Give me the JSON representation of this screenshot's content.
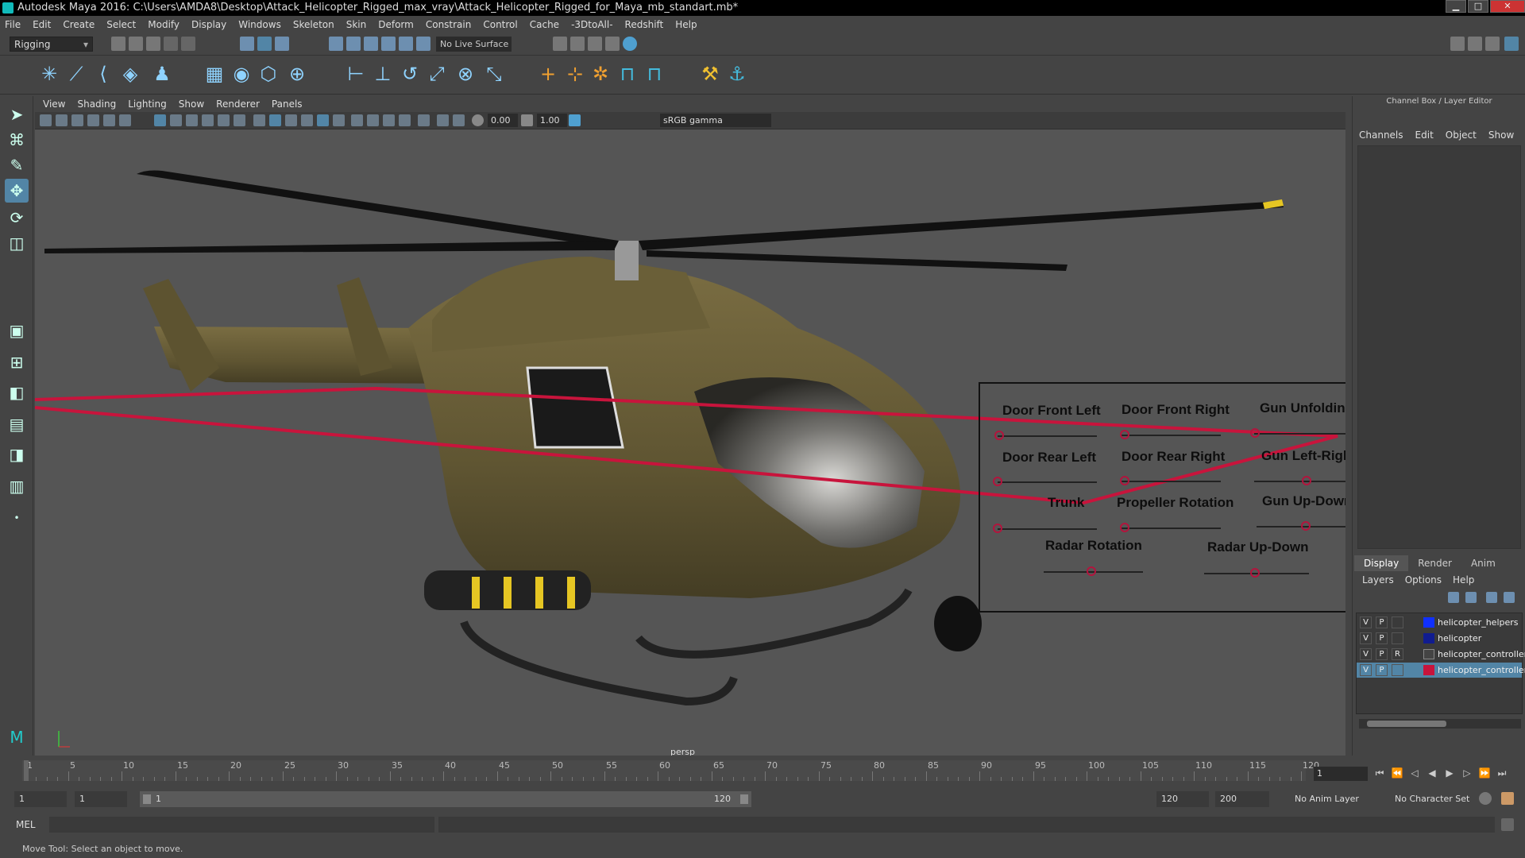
{
  "window": {
    "title": "Autodesk Maya 2016: C:\\Users\\AMDA8\\Desktop\\Attack_Helicopter_Rigged_max_vray\\Attack_Helicopter_Rigged_for_Maya_mb_standart.mb*",
    "minimize": "▁",
    "maximize": "□",
    "close": "✕"
  },
  "menubar": [
    "File",
    "Edit",
    "Create",
    "Select",
    "Modify",
    "Display",
    "Windows",
    "Skeleton",
    "Skin",
    "Deform",
    "Constrain",
    "Control",
    "Cache",
    "-3DtoAll-",
    "Redshift",
    "Help"
  ],
  "status": {
    "mode": "Rigging",
    "live_surface": "No Live Surface"
  },
  "viewport": {
    "menu": [
      "View",
      "Shading",
      "Lighting",
      "Show",
      "Renderer",
      "Panels"
    ],
    "exposure": "0.00",
    "gamma": "1.00",
    "color_space": "sRGB gamma",
    "camera_label": "persp"
  },
  "controls": {
    "door_front_left": "Door Front Left",
    "door_front_right": "Door Front Right",
    "gun_unfolding": "Gun Unfolding",
    "door_rear_left": "Door Rear Left",
    "door_rear_right": "Door Rear Right",
    "gun_left_right": "Gun Left-Right",
    "trunk": "Trunk",
    "propeller_rotation": "Propeller Rotation",
    "gun_up_down": "Gun Up-Down",
    "radar_rotation": "Radar Rotation",
    "radar_up_down": "Radar Up-Down"
  },
  "channel_box": {
    "title": "Channel Box / Layer Editor",
    "menu": [
      "Channels",
      "Edit",
      "Object",
      "Show"
    ],
    "layer_tabs": [
      "Display",
      "Render",
      "Anim"
    ],
    "layer_menu": [
      "Layers",
      "Options",
      "Help"
    ],
    "layers": [
      {
        "v": "V",
        "p": "P",
        "r": "",
        "color": "#1030ff",
        "name": "helicopter_helpers"
      },
      {
        "v": "V",
        "p": "P",
        "r": "",
        "color": "#101c90",
        "name": "helicopter"
      },
      {
        "v": "V",
        "p": "P",
        "r": "R",
        "color": "#444444",
        "name": "helicopter_controllers"
      },
      {
        "v": "V",
        "p": "P",
        "r": "",
        "color": "#c8143c",
        "name": "helicopter_controllers"
      }
    ]
  },
  "timeline": {
    "ticks": [
      "1",
      "5",
      "10",
      "15",
      "20",
      "25",
      "30",
      "35",
      "40",
      "45",
      "50",
      "55",
      "60",
      "65",
      "70",
      "75",
      "80",
      "85",
      "90",
      "95",
      "100",
      "105",
      "110",
      "115",
      "120"
    ],
    "current_frame": "1"
  },
  "range": {
    "start": "1",
    "anim_start": "1",
    "slider_start": "1",
    "slider_end": "120",
    "anim_end": "120",
    "end": "200",
    "anim_layer": "No Anim Layer",
    "character_set": "No Character Set"
  },
  "command": {
    "language": "MEL"
  },
  "help_line": "Move Tool: Select an object to move.",
  "colors": {
    "accent": "#5285a6",
    "controller": "#c8143c",
    "helicopter_body": "#6b6038"
  }
}
